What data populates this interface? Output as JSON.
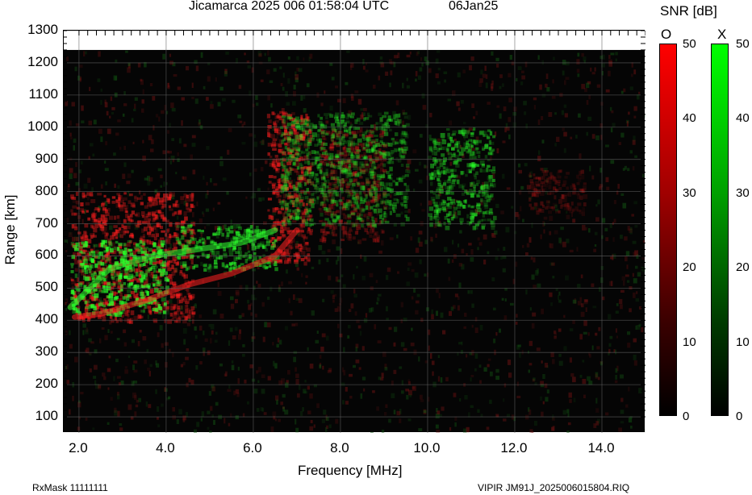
{
  "header": {
    "title": "Jicamarca 2025 006 01:58:04 UTC",
    "date": "06Jan25"
  },
  "footer": {
    "rxmask": "RxMask 11111111",
    "file": "VIPIR  JM91J_2025006015804.RIQ"
  },
  "colorbar": {
    "title": "SNR [dB]",
    "o_label": "O",
    "x_label": "X",
    "ticks": [
      "50",
      "40",
      "30",
      "20",
      "10",
      "0"
    ],
    "range": [
      0,
      50
    ],
    "o_color": "#ff0000",
    "x_color": "#00ff00"
  },
  "chart_data": {
    "type": "heatmap",
    "title": "Jicamarca 2025 006 01:58:04 UTC",
    "xlabel": "Frequency [MHz]",
    "ylabel": "Range [km]",
    "xlim": [
      1.65,
      15.0
    ],
    "ylim": [
      50,
      1300
    ],
    "xticks": [
      "2.0",
      "4.0",
      "6.0",
      "8.0",
      "10.0",
      "12.0",
      "14.0"
    ],
    "yticks": [
      "100",
      "200",
      "300",
      "400",
      "500",
      "600",
      "700",
      "800",
      "900",
      "1000",
      "1100",
      "1200",
      "1300"
    ],
    "grid": true,
    "data_top_km": 1240,
    "series": [
      {
        "name": "O",
        "trace": [
          [
            1.9,
            410
          ],
          [
            2.5,
            420
          ],
          [
            3.5,
            460
          ],
          [
            4.5,
            510
          ],
          [
            5.5,
            545
          ],
          [
            6.5,
            600
          ],
          [
            7.0,
            680
          ]
        ],
        "echo_regions": [
          {
            "freq": [
              1.8,
              4.6
            ],
            "range": [
              400,
              800
            ],
            "snr_db": 30
          },
          {
            "freq": [
              6.3,
              7.3
            ],
            "range": [
              580,
              1050
            ],
            "snr_db": 30
          },
          {
            "freq": [
              7.5,
              9.0
            ],
            "range": [
              650,
              1000
            ],
            "snr_db": 15
          },
          {
            "freq": [
              12.3,
              13.6
            ],
            "range": [
              740,
              870
            ],
            "snr_db": 10
          }
        ]
      },
      {
        "name": "X",
        "trace": [
          [
            1.8,
            440
          ],
          [
            2.7,
            560
          ],
          [
            3.7,
            600
          ],
          [
            4.7,
            620
          ],
          [
            5.7,
            640
          ],
          [
            6.5,
            680
          ]
        ],
        "echo_regions": [
          {
            "freq": [
              1.8,
              4.0
            ],
            "range": [
              420,
              650
            ],
            "snr_db": 40
          },
          {
            "freq": [
              4.2,
              6.5
            ],
            "range": [
              560,
              700
            ],
            "snr_db": 30
          },
          {
            "freq": [
              6.6,
              9.5
            ],
            "range": [
              700,
              1050
            ],
            "snr_db": 20
          },
          {
            "freq": [
              10.0,
              11.5
            ],
            "range": [
              690,
              1000
            ],
            "snr_db": 25
          }
        ]
      }
    ]
  }
}
